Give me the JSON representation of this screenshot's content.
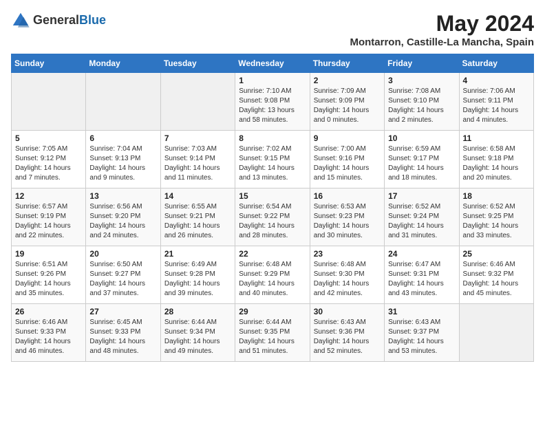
{
  "header": {
    "logo_general": "General",
    "logo_blue": "Blue",
    "title": "May 2024",
    "location": "Montarron, Castille-La Mancha, Spain"
  },
  "days_of_week": [
    "Sunday",
    "Monday",
    "Tuesday",
    "Wednesday",
    "Thursday",
    "Friday",
    "Saturday"
  ],
  "weeks": [
    [
      {
        "day": "",
        "sunrise": "",
        "sunset": "",
        "daylight": "",
        "empty": true
      },
      {
        "day": "",
        "sunrise": "",
        "sunset": "",
        "daylight": "",
        "empty": true
      },
      {
        "day": "",
        "sunrise": "",
        "sunset": "",
        "daylight": "",
        "empty": true
      },
      {
        "day": "1",
        "sunrise": "Sunrise: 7:10 AM",
        "sunset": "Sunset: 9:08 PM",
        "daylight": "Daylight: 13 hours and 58 minutes."
      },
      {
        "day": "2",
        "sunrise": "Sunrise: 7:09 AM",
        "sunset": "Sunset: 9:09 PM",
        "daylight": "Daylight: 14 hours and 0 minutes."
      },
      {
        "day": "3",
        "sunrise": "Sunrise: 7:08 AM",
        "sunset": "Sunset: 9:10 PM",
        "daylight": "Daylight: 14 hours and 2 minutes."
      },
      {
        "day": "4",
        "sunrise": "Sunrise: 7:06 AM",
        "sunset": "Sunset: 9:11 PM",
        "daylight": "Daylight: 14 hours and 4 minutes."
      }
    ],
    [
      {
        "day": "5",
        "sunrise": "Sunrise: 7:05 AM",
        "sunset": "Sunset: 9:12 PM",
        "daylight": "Daylight: 14 hours and 7 minutes."
      },
      {
        "day": "6",
        "sunrise": "Sunrise: 7:04 AM",
        "sunset": "Sunset: 9:13 PM",
        "daylight": "Daylight: 14 hours and 9 minutes."
      },
      {
        "day": "7",
        "sunrise": "Sunrise: 7:03 AM",
        "sunset": "Sunset: 9:14 PM",
        "daylight": "Daylight: 14 hours and 11 minutes."
      },
      {
        "day": "8",
        "sunrise": "Sunrise: 7:02 AM",
        "sunset": "Sunset: 9:15 PM",
        "daylight": "Daylight: 14 hours and 13 minutes."
      },
      {
        "day": "9",
        "sunrise": "Sunrise: 7:00 AM",
        "sunset": "Sunset: 9:16 PM",
        "daylight": "Daylight: 14 hours and 15 minutes."
      },
      {
        "day": "10",
        "sunrise": "Sunrise: 6:59 AM",
        "sunset": "Sunset: 9:17 PM",
        "daylight": "Daylight: 14 hours and 18 minutes."
      },
      {
        "day": "11",
        "sunrise": "Sunrise: 6:58 AM",
        "sunset": "Sunset: 9:18 PM",
        "daylight": "Daylight: 14 hours and 20 minutes."
      }
    ],
    [
      {
        "day": "12",
        "sunrise": "Sunrise: 6:57 AM",
        "sunset": "Sunset: 9:19 PM",
        "daylight": "Daylight: 14 hours and 22 minutes."
      },
      {
        "day": "13",
        "sunrise": "Sunrise: 6:56 AM",
        "sunset": "Sunset: 9:20 PM",
        "daylight": "Daylight: 14 hours and 24 minutes."
      },
      {
        "day": "14",
        "sunrise": "Sunrise: 6:55 AM",
        "sunset": "Sunset: 9:21 PM",
        "daylight": "Daylight: 14 hours and 26 minutes."
      },
      {
        "day": "15",
        "sunrise": "Sunrise: 6:54 AM",
        "sunset": "Sunset: 9:22 PM",
        "daylight": "Daylight: 14 hours and 28 minutes."
      },
      {
        "day": "16",
        "sunrise": "Sunrise: 6:53 AM",
        "sunset": "Sunset: 9:23 PM",
        "daylight": "Daylight: 14 hours and 30 minutes."
      },
      {
        "day": "17",
        "sunrise": "Sunrise: 6:52 AM",
        "sunset": "Sunset: 9:24 PM",
        "daylight": "Daylight: 14 hours and 31 minutes."
      },
      {
        "day": "18",
        "sunrise": "Sunrise: 6:52 AM",
        "sunset": "Sunset: 9:25 PM",
        "daylight": "Daylight: 14 hours and 33 minutes."
      }
    ],
    [
      {
        "day": "19",
        "sunrise": "Sunrise: 6:51 AM",
        "sunset": "Sunset: 9:26 PM",
        "daylight": "Daylight: 14 hours and 35 minutes."
      },
      {
        "day": "20",
        "sunrise": "Sunrise: 6:50 AM",
        "sunset": "Sunset: 9:27 PM",
        "daylight": "Daylight: 14 hours and 37 minutes."
      },
      {
        "day": "21",
        "sunrise": "Sunrise: 6:49 AM",
        "sunset": "Sunset: 9:28 PM",
        "daylight": "Daylight: 14 hours and 39 minutes."
      },
      {
        "day": "22",
        "sunrise": "Sunrise: 6:48 AM",
        "sunset": "Sunset: 9:29 PM",
        "daylight": "Daylight: 14 hours and 40 minutes."
      },
      {
        "day": "23",
        "sunrise": "Sunrise: 6:48 AM",
        "sunset": "Sunset: 9:30 PM",
        "daylight": "Daylight: 14 hours and 42 minutes."
      },
      {
        "day": "24",
        "sunrise": "Sunrise: 6:47 AM",
        "sunset": "Sunset: 9:31 PM",
        "daylight": "Daylight: 14 hours and 43 minutes."
      },
      {
        "day": "25",
        "sunrise": "Sunrise: 6:46 AM",
        "sunset": "Sunset: 9:32 PM",
        "daylight": "Daylight: 14 hours and 45 minutes."
      }
    ],
    [
      {
        "day": "26",
        "sunrise": "Sunrise: 6:46 AM",
        "sunset": "Sunset: 9:33 PM",
        "daylight": "Daylight: 14 hours and 46 minutes."
      },
      {
        "day": "27",
        "sunrise": "Sunrise: 6:45 AM",
        "sunset": "Sunset: 9:33 PM",
        "daylight": "Daylight: 14 hours and 48 minutes."
      },
      {
        "day": "28",
        "sunrise": "Sunrise: 6:44 AM",
        "sunset": "Sunset: 9:34 PM",
        "daylight": "Daylight: 14 hours and 49 minutes."
      },
      {
        "day": "29",
        "sunrise": "Sunrise: 6:44 AM",
        "sunset": "Sunset: 9:35 PM",
        "daylight": "Daylight: 14 hours and 51 minutes."
      },
      {
        "day": "30",
        "sunrise": "Sunrise: 6:43 AM",
        "sunset": "Sunset: 9:36 PM",
        "daylight": "Daylight: 14 hours and 52 minutes."
      },
      {
        "day": "31",
        "sunrise": "Sunrise: 6:43 AM",
        "sunset": "Sunset: 9:37 PM",
        "daylight": "Daylight: 14 hours and 53 minutes."
      },
      {
        "day": "",
        "sunrise": "",
        "sunset": "",
        "daylight": "",
        "empty": true
      }
    ]
  ]
}
